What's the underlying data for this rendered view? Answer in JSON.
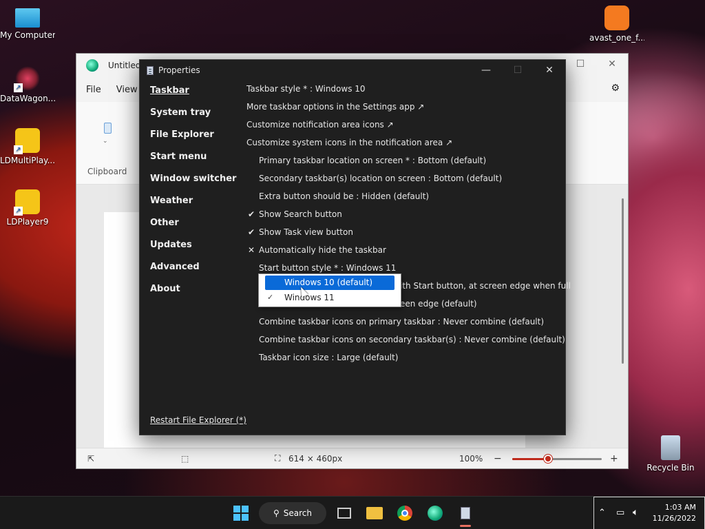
{
  "desktop": {
    "icons": [
      {
        "name": "desktop-icon-my-computer",
        "label": "My Computer"
      },
      {
        "name": "desktop-icon-datawagon",
        "label": "DataWagon..."
      },
      {
        "name": "desktop-icon-ldmultiplayer",
        "label": "LDMultiPlay..."
      },
      {
        "name": "desktop-icon-ldplayer9",
        "label": "LDPlayer9"
      },
      {
        "name": "desktop-icon-avast",
        "label": "avast_one_f..."
      },
      {
        "name": "desktop-icon-recycle-bin",
        "label": "Recycle Bin"
      }
    ]
  },
  "paint": {
    "title": "Untitled",
    "menu": [
      "File",
      "View"
    ],
    "ribbon_group": "Clipboard",
    "status": {
      "canvas_size": "614 × 460px",
      "zoom": "100%",
      "zoom_level": 0.4
    }
  },
  "props": {
    "title": "Properties",
    "nav": [
      "Taskbar",
      "System tray",
      "File Explorer",
      "Start menu",
      "Window switcher",
      "Weather",
      "Other",
      "Updates",
      "Advanced",
      "About"
    ],
    "settings": [
      {
        "text": "Taskbar style * : Windows 10",
        "indent": false,
        "mark": ""
      },
      {
        "text": "More taskbar options in the Settings app ↗",
        "indent": false,
        "mark": ""
      },
      {
        "text": "Customize notification area icons ↗",
        "indent": false,
        "mark": ""
      },
      {
        "text": "Customize system icons in the notification area ↗",
        "indent": false,
        "mark": ""
      },
      {
        "text": "Primary taskbar location on screen * : Bottom (default)",
        "indent": true,
        "mark": ""
      },
      {
        "text": "Secondary taskbar(s) location on screen : Bottom (default)",
        "indent": true,
        "mark": ""
      },
      {
        "text": "Extra button should be : Hidden (default)",
        "indent": true,
        "mark": ""
      },
      {
        "text": "Show Search button",
        "indent": true,
        "mark": "✔"
      },
      {
        "text": "Show Task view button",
        "indent": true,
        "mark": "✔"
      },
      {
        "text": "Automatically hide the taskbar",
        "indent": true,
        "mark": "✕"
      },
      {
        "text": "Start button style * : Windows 11",
        "indent": true,
        "mark": ""
      },
      {
        "text": "ith Start button, at screen edge when full",
        "indent": true,
        "mark": ""
      },
      {
        "text": "een edge (default)",
        "indent": true,
        "mark": ""
      },
      {
        "text": "Combine taskbar icons on primary taskbar : Never combine (default)",
        "indent": true,
        "mark": ""
      },
      {
        "text": "Combine taskbar icons on secondary taskbar(s) : Never combine (default)",
        "indent": true,
        "mark": ""
      },
      {
        "text": "Taskbar icon size : Large (default)",
        "indent": true,
        "mark": ""
      }
    ],
    "restart": "Restart File Explorer (*)",
    "dropdown": {
      "options": [
        "Windows 10 (default)",
        "Windows 11"
      ],
      "highlighted": 0,
      "checked": 1
    }
  },
  "taskbar": {
    "search_label": "Search",
    "time": "1:03 AM",
    "date": "11/26/2022"
  },
  "colors": {
    "accent": "#0a6ad8",
    "paint_accent": "#c42b1c"
  }
}
